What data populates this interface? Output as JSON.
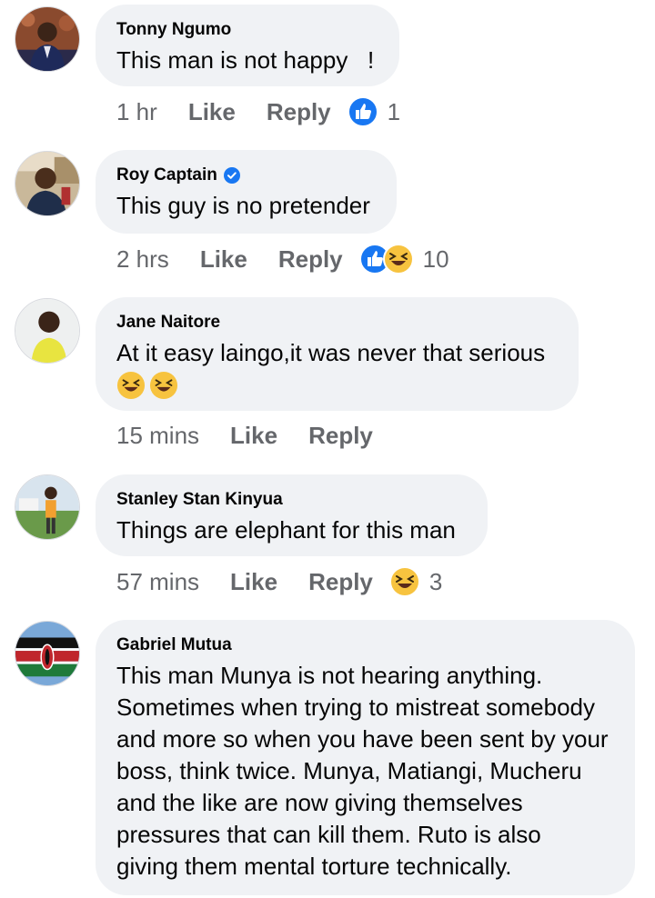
{
  "comments": [
    {
      "author": "Tonny Ngumo",
      "verified": false,
      "text": "This man is not happy   !",
      "time": "1 hr",
      "like_label": "Like",
      "reply_label": "Reply",
      "reactions": [
        "like-icon"
      ],
      "reaction_count": "1"
    },
    {
      "author": "Roy Captain",
      "verified": true,
      "text": "This guy is no pretender",
      "time": "2 hrs",
      "like_label": "Like",
      "reply_label": "Reply",
      "reactions": [
        "like-icon",
        "haha-icon"
      ],
      "reaction_count": "10"
    },
    {
      "author": "Jane Naitore",
      "verified": false,
      "text": "At it easy laingo,it was never that serious",
      "emoji": [
        "laughing-emoji",
        "laughing-emoji"
      ],
      "time": "15 mins",
      "like_label": "Like",
      "reply_label": "Reply",
      "reactions": [],
      "reaction_count": ""
    },
    {
      "author": "Stanley Stan Kinyua",
      "verified": false,
      "text": "Things are elephant for this man",
      "time": "57 mins",
      "like_label": "Like",
      "reply_label": "Reply",
      "reactions": [
        "haha-icon"
      ],
      "reaction_count": "3"
    },
    {
      "author": "Gabriel Mutua",
      "verified": false,
      "text": "This man Munya is not hearing anything.\nSometimes when trying to mistreat somebody\nand more so when you have been sent by your\nboss, think twice. Munya, Matiangi, Mucheru\nand the like are now giving themselves\npressures that can kill them. Ruto is also\ngiving them mental torture technically."
    }
  ],
  "colors": {
    "bubble": "#f0f2f5",
    "meta": "#65676b",
    "like_blue": "#1877f2",
    "haha_yellow": "#f7c33f"
  }
}
